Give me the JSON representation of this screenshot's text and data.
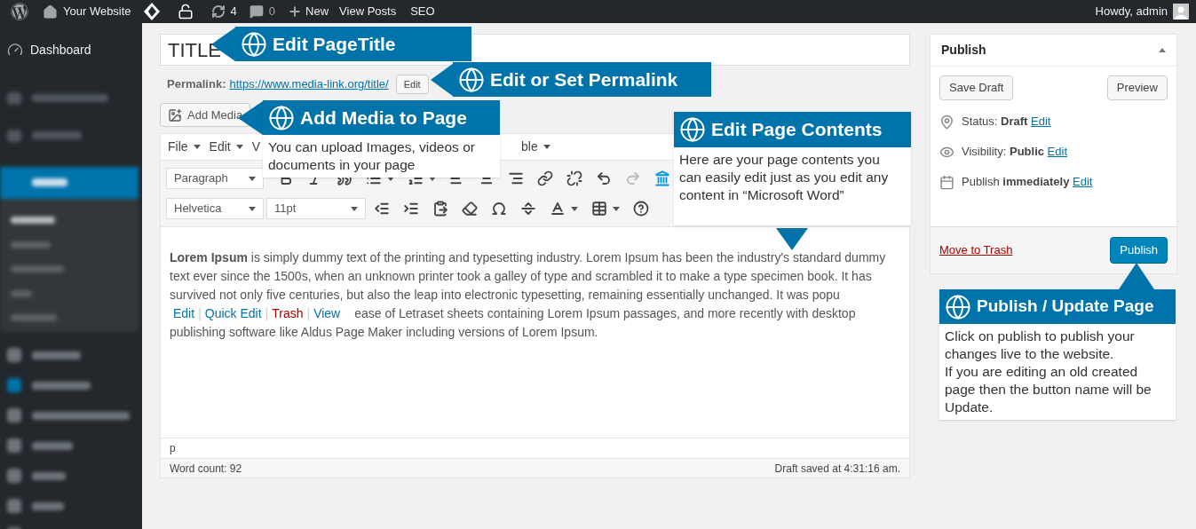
{
  "admin_bar": {
    "site": "Your Website",
    "updates": "4",
    "comments": "0",
    "new": "New",
    "links": [
      "View Posts",
      "SEO"
    ],
    "greeting": "Howdy, admin"
  },
  "sidebar": {
    "items": [
      {
        "label": "Dashboard"
      }
    ]
  },
  "editor": {
    "title": "TITLE",
    "permalink_label": "Permalink:",
    "permalink_url": "https://www.media-link.org/title/",
    "permalink_edit": "Edit",
    "add_media": "Add Media",
    "menus": [
      "File",
      "Edit",
      "V",
      "ble"
    ],
    "format": "Paragraph",
    "font": "Helvetica",
    "size": "11pt",
    "text_before": "**Lorem Ipsum** is simply dummy text of the printing and typesetting industry. Lorem Ipsum has been the industry's standard dummy text ever since the 1500s, when an unknown printer took a galley of type and scrambled it to make a type specimen book. It has survived not only five centuries, but also the leap into electronic typesetting, remaining essentially unchanged. It was popu",
    "separator": "|",
    "row_actions": [
      {
        "label": "Edit",
        "kind": "normal"
      },
      {
        "label": "Quick Edit",
        "kind": "normal"
      },
      {
        "label": "Trash",
        "kind": "danger"
      },
      {
        "label": "View",
        "kind": "normal"
      }
    ],
    "text_after": "ease of Letraset sheets containing Lorem Ipsum passages, and more recently with desktop publishing software like Aldus Page Maker including versions of Lorem Ipsum.",
    "path": "p",
    "word_count": "Word count: 92",
    "draft_saved": "Draft saved at 4:31:16 am."
  },
  "publish": {
    "title": "Publish",
    "save_draft": "Save Draft",
    "preview": "Preview",
    "rows": [
      {
        "kind": "status",
        "label": "Status:",
        "value": "Draft",
        "link": "Edit"
      },
      {
        "kind": "visibility",
        "label": "Visibility:",
        "value": "Public",
        "link": "Edit"
      },
      {
        "kind": "schedule",
        "label": "Publish",
        "value": "immediately",
        "link": "Edit"
      }
    ],
    "trash": "Move to Trash",
    "button": "Publish"
  },
  "callouts": [
    {
      "title": "Edit PageTitle"
    },
    {
      "title": "Edit or Set Permalink"
    },
    {
      "title": "Add Media to Page",
      "body": "You can upload Images, videos or documents in your page"
    },
    {
      "title": "Edit Page Contents",
      "body": "Here are your page contents you can easily edit just as you edit any content in “Microsoft Word”"
    },
    {
      "title": "Publish / Update Page",
      "body": "Click on publish to publish your changes live to the website.\nIf you are editing an old created page then the button name will be Update."
    }
  ]
}
